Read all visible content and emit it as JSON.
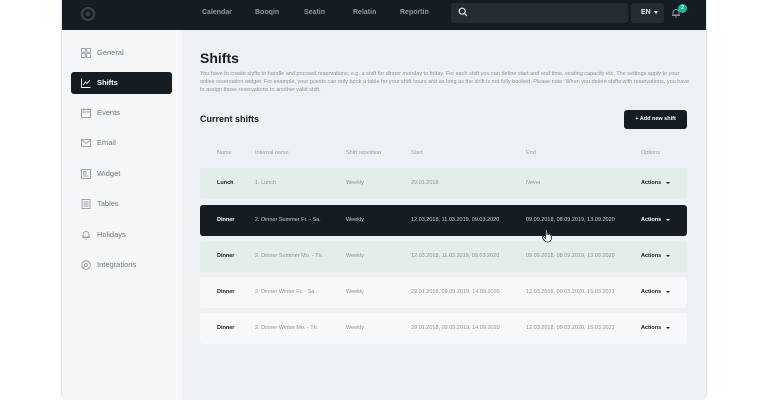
{
  "topbar": {
    "nav": [
      "Calendar",
      "Booqin",
      "Seatin",
      "Relatin",
      "Reportin"
    ],
    "search": {
      "placeholder": ""
    },
    "language": "EN",
    "notifications_count": "2"
  },
  "sidebar": {
    "items": [
      {
        "label": "General",
        "icon": "grid-icon"
      },
      {
        "label": "Shifts",
        "icon": "chart-icon",
        "active": true
      },
      {
        "label": "Events",
        "icon": "calendar-icon"
      },
      {
        "label": "Email",
        "icon": "mail-icon"
      },
      {
        "label": "Widget",
        "icon": "widget-icon"
      },
      {
        "label": "Tables",
        "icon": "table-icon"
      },
      {
        "label": "Holidays",
        "icon": "bell-icon"
      },
      {
        "label": "Integrations",
        "icon": "integrations-icon"
      }
    ]
  },
  "main": {
    "title": "Shifts",
    "description": "You have to create shifts to handle and proceed reservations, e.g. a shift for dinner monday to friday. For each shift you can define start and end time, seating capacity etc. The settings apply to your online reservation widget. For example, your guests can only book a table for your shift hours and as long as the shift is not fully booked. Please note: When you delete shifts with reservations, you have to assign those reservations to another valid shift.",
    "current_shifts_title": "Current shifts",
    "add_button": "+ Add new shift",
    "table": {
      "headers": [
        "Name",
        "Internal name",
        "Shift repetition",
        "Start",
        "End",
        "Options"
      ],
      "rows": [
        {
          "name": "Lunch",
          "internal": "1. Lunch",
          "repetition": "Weekly",
          "start": "29.01.2018",
          "end": "Never",
          "options": "Actions"
        },
        {
          "name": "Dinner",
          "internal": "2. Dinner Summer Fr. - Sa.",
          "repetition": "Weekly",
          "start": "12.03.2018, 11.03.2019, 09.03.2020",
          "end": "09.09.2018, 08.09.2019, 13.09.2020",
          "options": "Actions"
        },
        {
          "name": "Dinner",
          "internal": "2. Dinner Summer Mo. - Th.",
          "repetition": "Weekly",
          "start": "12.03.2018, 11.03.2019, 09.03.2020",
          "end": "09.09.2018, 08.09.2019, 13.09.2020",
          "options": "Actions"
        },
        {
          "name": "Dinner",
          "internal": "2. Dinner Winter Fr. - Sa.",
          "repetition": "Weekly",
          "start": "29.01.2018, 09.09.2019, 14.09.2020",
          "end": "12.03.2018, 09.03.2020, 15.03.2021",
          "options": "Actions"
        },
        {
          "name": "Dinner",
          "internal": "2. Dinner Winter Mo. - Th.",
          "repetition": "Weekly",
          "start": "29.01.2018, 09.09.2019, 14.09.2020",
          "end": "12.03.2018, 09.03.2020, 15.03.2021",
          "options": "Actions"
        }
      ]
    }
  },
  "colors": {
    "dark": "#161d22",
    "accent": "#1bb99a",
    "row_highlight": "#e3eeea"
  }
}
